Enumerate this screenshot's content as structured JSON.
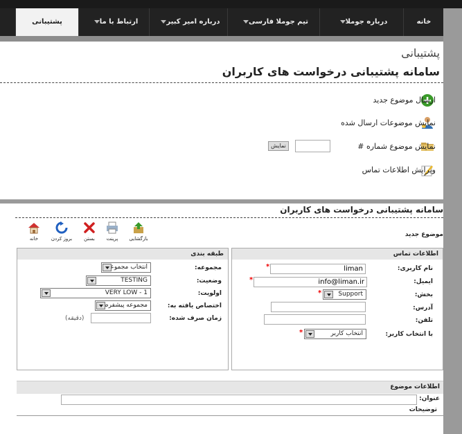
{
  "nav": {
    "tabs": [
      {
        "label": "خانه"
      },
      {
        "label": "درباره جوملا"
      },
      {
        "label": "تیم جوملا فارسی"
      },
      {
        "label": "درباره امیر کبیر"
      },
      {
        "label": "ارتباط با ما"
      },
      {
        "label": "پشتیبانی"
      }
    ]
  },
  "support": {
    "heading": "پشتیبانی",
    "title": "سامانه پشتیبانی درخواست های کاربران",
    "links": {
      "new_topic": "ارسال موضوع جدید",
      "show_topics": "نمایش موضوعات ارسال شده",
      "show_topic_number": "نمایش موضوع شماره #",
      "show_button": "نمایش",
      "edit_contact": "ویرایش اطلاعات تماس"
    }
  },
  "form": {
    "title": "سامانه پشتیبانی درخواست های کاربران",
    "subtitle": "موضوع جدید",
    "toolbar": {
      "back": "بازگشایی",
      "print": "پرینت",
      "close": "بستن",
      "refresh": "بروز کردن",
      "home": "خانه"
    },
    "contact": {
      "heading": "اطلاعات تماس",
      "username_label": "نام کاربری:",
      "username_value": "liman",
      "email_label": "ایمیل:",
      "email_value": "info@liman.ir",
      "department_label": "بخش:",
      "department_value": "Support",
      "address_label": "آدرس:",
      "phone_label": "تلفن:",
      "select_user_label": "با انتخاب کاربر:",
      "select_user_value": "انتخاب کاربر"
    },
    "category": {
      "heading": "طبقه بندی",
      "group_label": "مجموعه:",
      "group_value": "انتخاب مجموعه",
      "status_label": "وضعیت:",
      "status_value": "TESTING",
      "priority_label": "اولویت:",
      "priority_value": "VERY LOW - 1",
      "assign_label": "اختصاص یافته به:",
      "assign_value": "مجموعه پیشفرض",
      "time_label": "زمان صرف شده:",
      "time_unit": "(دقیقه)"
    },
    "topic": {
      "heading": "اطلاعات موضوع",
      "title_label": "عنوان:",
      "description_label": "توضیحات"
    }
  }
}
